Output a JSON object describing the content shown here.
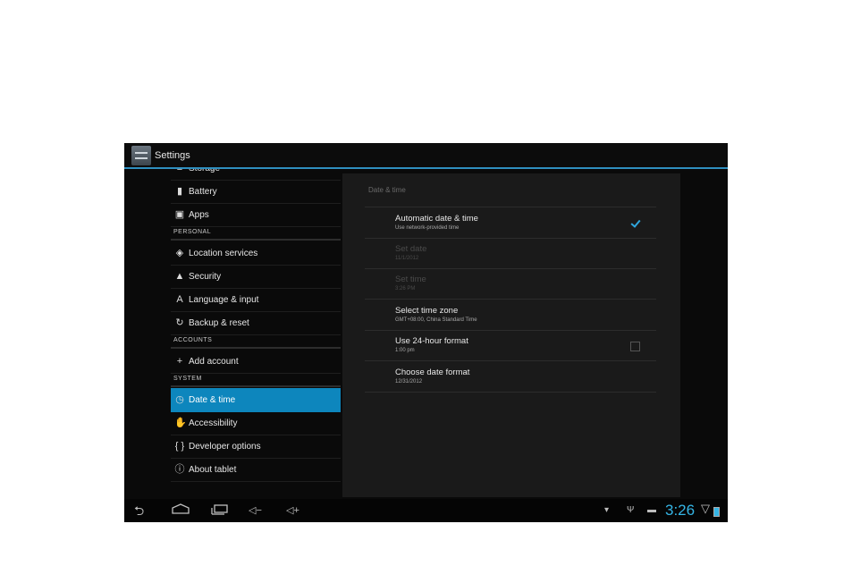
{
  "action_bar": {
    "title": "Settings",
    "app_icon": "settings-icon"
  },
  "sidebar": {
    "items": [
      {
        "type": "item",
        "label": "Storage",
        "icon": "storage-icon"
      },
      {
        "type": "item",
        "label": "Battery",
        "icon": "battery-icon"
      },
      {
        "type": "item",
        "label": "Apps",
        "icon": "apps-icon"
      },
      {
        "type": "header",
        "label": "PERSONAL"
      },
      {
        "type": "item",
        "label": "Location services",
        "icon": "location-icon"
      },
      {
        "type": "item",
        "label": "Security",
        "icon": "lock-icon"
      },
      {
        "type": "item",
        "label": "Language & input",
        "icon": "keyboard-icon"
      },
      {
        "type": "item",
        "label": "Backup & reset",
        "icon": "backup-icon"
      },
      {
        "type": "header",
        "label": "ACCOUNTS"
      },
      {
        "type": "item",
        "label": "Add account",
        "icon": "plus-icon"
      },
      {
        "type": "header",
        "label": "SYSTEM"
      },
      {
        "type": "item",
        "label": "Date & time",
        "icon": "clock-icon",
        "selected": true
      },
      {
        "type": "item",
        "label": "Accessibility",
        "icon": "hand-icon"
      },
      {
        "type": "item",
        "label": "Developer options",
        "icon": "braces-icon"
      },
      {
        "type": "item",
        "label": "About tablet",
        "icon": "info-icon"
      }
    ]
  },
  "detail": {
    "title": "Date & time",
    "rows": [
      {
        "title": "Automatic date & time",
        "summary": "Use network-provided time",
        "checkbox": "checked",
        "enabled": true
      },
      {
        "title": "Set date",
        "summary": "11/1/2012",
        "enabled": false
      },
      {
        "title": "Set time",
        "summary": "3:26 PM",
        "enabled": false
      },
      {
        "title": "Select time zone",
        "summary": "GMT+08:00, China Standard Time",
        "enabled": true
      },
      {
        "title": "Use 24-hour format",
        "summary": "1:00 pm",
        "checkbox": "unchecked",
        "enabled": true
      },
      {
        "title": "Choose date format",
        "summary": "12/31/2012",
        "enabled": true
      }
    ]
  },
  "navbar": {
    "buttons": [
      "back-icon",
      "home-icon",
      "recent-apps-icon",
      "volume-down-icon",
      "volume-up-icon"
    ],
    "status_icons": [
      "wifi-icon",
      "usb-icon",
      "android-debug-icon"
    ],
    "clock": "3:26",
    "accent_color": "#35b5e5"
  }
}
